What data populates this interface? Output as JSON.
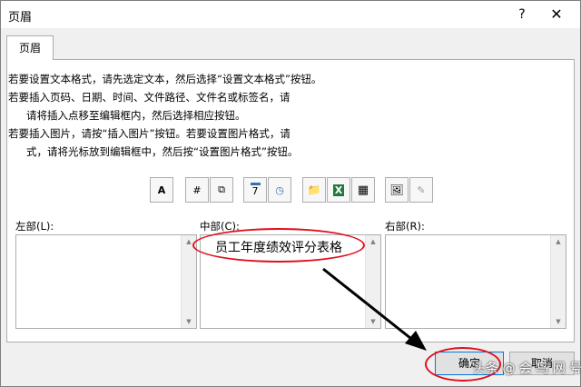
{
  "dialog": {
    "title": "页眉",
    "help_glyph": "?",
    "close_glyph": "✕"
  },
  "tab": {
    "label": "页眉"
  },
  "instructions": [
    "若要设置文本格式，请先选定文本，然后选择“设置文本格式”按钮。",
    "若要插入页码、日期、时间、文件路径、文件名或标签名，请",
    "请将插入点移至编辑框内，然后选择相应按钮。",
    "若要插入图片，请按“插入图片”按钮。若要设置图片格式，请",
    "式，请将光标放到编辑框中，然后按“设置图片格式”按钮。"
  ],
  "toolbar": {
    "format_text_glyph": "A",
    "page_number_glyph": "#",
    "page_count_glyph": "⧉",
    "date_glyph": "7",
    "time_glyph": "◷",
    "file_path_glyph": "📁",
    "file_name_glyph": "X",
    "sheet_name_glyph": "▦",
    "insert_picture_glyph": "🖼",
    "format_picture_glyph": "✎"
  },
  "sections": {
    "left": {
      "label": "左部(L):",
      "value": ""
    },
    "center": {
      "label": "中部(C):",
      "value": "员工年度绩效评分表格"
    },
    "right": {
      "label": "右部(R):",
      "value": ""
    }
  },
  "buttons": {
    "ok": "确定",
    "cancel": "取消"
  },
  "watermark": "头条 @ 会 鸟 网 号",
  "colors": {
    "annotation": "#e0101e",
    "ok_border": "#0078d7"
  }
}
